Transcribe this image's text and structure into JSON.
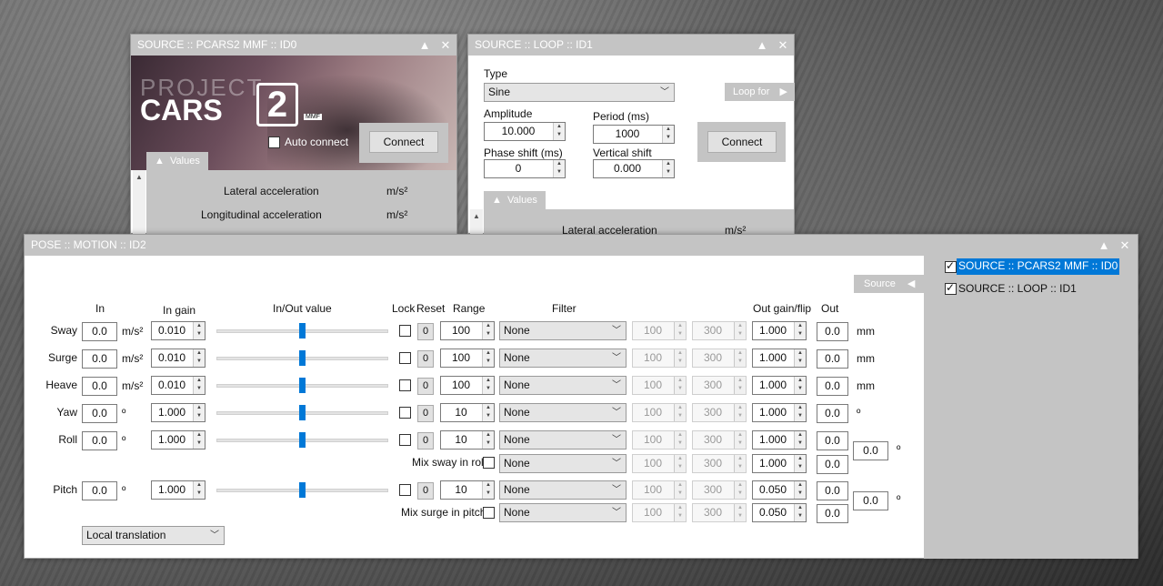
{
  "pcars": {
    "title": "SOURCE :: PCARS2 MMF :: ID0",
    "logo_top": "PROJECT",
    "logo_main": "CARS",
    "logo_num": "2",
    "logo_sub": "MMF",
    "auto_connect": "Auto connect",
    "connect": "Connect",
    "values_tab": "Values",
    "rows": [
      {
        "label": "Lateral acceleration",
        "unit": "m/s²"
      },
      {
        "label": "Longitudinal acceleration",
        "unit": "m/s²"
      }
    ]
  },
  "loop": {
    "title": "SOURCE :: LOOP :: ID1",
    "type_label": "Type",
    "type_value": "Sine",
    "loop_for": "Loop for",
    "amplitude_label": "Amplitude",
    "amplitude": "10.000",
    "period_label": "Period (ms)",
    "period": "1000",
    "phase_label": "Phase shift (ms)",
    "phase": "0",
    "vshift_label": "Vertical shift",
    "vshift": "0.000",
    "connect": "Connect",
    "values_tab": "Values",
    "row_label": "Lateral acceleration",
    "row_unit": "m/s²"
  },
  "pose": {
    "title": "POSE :: MOTION :: ID2",
    "source_btn": "Source",
    "headers": {
      "in": "In",
      "in_gain": "In gain",
      "inout": "In/Out value",
      "lock": "Lock",
      "reset": "Reset",
      "range": "Range",
      "filter": "Filter",
      "out_gain": "Out gain/flip",
      "out": "Out"
    },
    "rows": [
      {
        "name": "Sway",
        "in": "0.0",
        "in_unit": "m/s²",
        "gain": "0.010",
        "reset": "0",
        "range": "100",
        "filter": "None",
        "f1": "100",
        "f2": "300",
        "ogain": "1.000",
        "out": "0.0",
        "out_unit": "mm"
      },
      {
        "name": "Surge",
        "in": "0.0",
        "in_unit": "m/s²",
        "gain": "0.010",
        "reset": "0",
        "range": "100",
        "filter": "None",
        "f1": "100",
        "f2": "300",
        "ogain": "1.000",
        "out": "0.0",
        "out_unit": "mm"
      },
      {
        "name": "Heave",
        "in": "0.0",
        "in_unit": "m/s²",
        "gain": "0.010",
        "reset": "0",
        "range": "100",
        "filter": "None",
        "f1": "100",
        "f2": "300",
        "ogain": "1.000",
        "out": "0.0",
        "out_unit": "mm"
      },
      {
        "name": "Yaw",
        "in": "0.0",
        "in_unit": "º",
        "gain": "1.000",
        "reset": "0",
        "range": "10",
        "filter": "None",
        "f1": "100",
        "f2": "300",
        "ogain": "1.000",
        "out": "0.0",
        "out_unit": "º"
      },
      {
        "name": "Roll",
        "in": "0.0",
        "in_unit": "º",
        "gain": "1.000",
        "reset": "0",
        "range": "10",
        "filter": "None",
        "f1": "100",
        "f2": "300",
        "ogain": "1.000",
        "out": "0.0",
        "out_unit": ""
      },
      {
        "name": "Pitch",
        "in": "0.0",
        "in_unit": "º",
        "gain": "1.000",
        "reset": "0",
        "range": "10",
        "filter": "None",
        "f1": "100",
        "f2": "300",
        "ogain": "0.050",
        "out": "0.0",
        "out_unit": ""
      }
    ],
    "mix_roll": {
      "label": "Mix sway in roll",
      "filter": "None",
      "f1": "100",
      "f2": "300",
      "ogain": "1.000",
      "out": "0.0",
      "total": "0.0",
      "unit": "º"
    },
    "mix_pitch": {
      "label": "Mix surge in pitch",
      "filter": "None",
      "f1": "100",
      "f2": "300",
      "ogain": "0.050",
      "out": "0.0",
      "total": "0.0",
      "unit": "º"
    },
    "mode": "Local translation",
    "sources": [
      {
        "label": "SOURCE :: PCARS2 MMF :: ID0"
      },
      {
        "label": "SOURCE :: LOOP :: ID1"
      }
    ]
  }
}
